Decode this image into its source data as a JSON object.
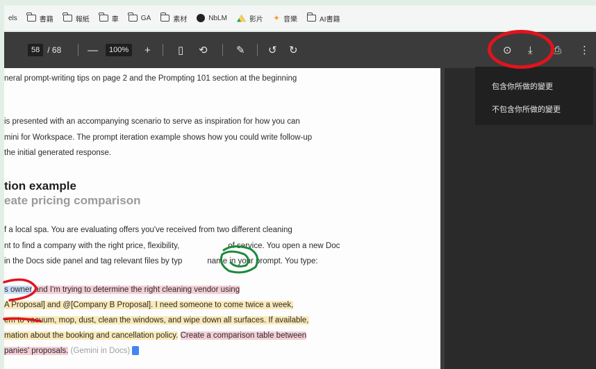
{
  "bookmarks": [
    {
      "label": "els",
      "icon": "none"
    },
    {
      "label": "書籍",
      "icon": "folder-icon"
    },
    {
      "label": "報紙",
      "icon": "folder-icon"
    },
    {
      "label": "車",
      "icon": "folder-icon"
    },
    {
      "label": "GA",
      "icon": "folder-icon"
    },
    {
      "label": "素材",
      "icon": "folder-icon"
    },
    {
      "label": "NbLM",
      "icon": "circle-icon"
    },
    {
      "label": "影片",
      "icon": "drive-icon"
    },
    {
      "label": "音樂",
      "icon": "star-icon"
    },
    {
      "label": "AI書籍",
      "icon": "folder-icon"
    }
  ],
  "toolbar": {
    "page_current": "58",
    "page_total": "/ 68",
    "zoom_out": "—",
    "zoom": "100%",
    "zoom_in": "+",
    "fit_icon": "▯",
    "rotate_icon": "⟲",
    "sign_icon": "✎",
    "undo_icon": "↺",
    "redo_icon": "↻",
    "save_icon": "⊙",
    "download_icon": "⤓",
    "print_icon": "⎙",
    "more_icon": "⋮"
  },
  "menu": {
    "item1": "包含你所做的變更",
    "item2": "不包含你所做的變更"
  },
  "document": {
    "line1": "neral prompt-writing tips on page 2 and the Prompting 101 section at the beginning",
    "line2": "is presented with an accompanying scenario to serve as inspiration for how you can",
    "line3": "mini for Workspace. The prompt iteration example shows how you could write follow-up",
    "line4": "the initial generated response.",
    "heading": "tion example",
    "subheading": "eate pricing comparison",
    "para1": "f a local spa. You are evaluating offers you've received from two different cleaning",
    "para2a": "nt to find a company with the right price, flexibility,",
    "para2b": "of service. You open a new Doc",
    "para3a": "in the Docs side panel and tag relevant files by typ",
    "para3b": "name in your prompt. You type:",
    "prompt1a": "s owner",
    "prompt1b": "and I'm trying to determine the right cleaning vendor using",
    "prompt2": "A Proposal] and @[Company B Proposal]. I need someone to come twice a week,",
    "prompt3": "em to vacuum, mop, dust, clean the windows, and wipe down all surfaces. If available,",
    "prompt4a": "mation about the booking and cancellation policy.",
    "prompt4b": "Create a comparison table between",
    "prompt5a": "panies' proposals.",
    "prompt5b": "(Gemini in Docs)"
  },
  "colors": {
    "annotation_red": "#e0141e",
    "annotation_green": "#1e8a3c",
    "toolbar_bg": "#3b3b3b"
  }
}
